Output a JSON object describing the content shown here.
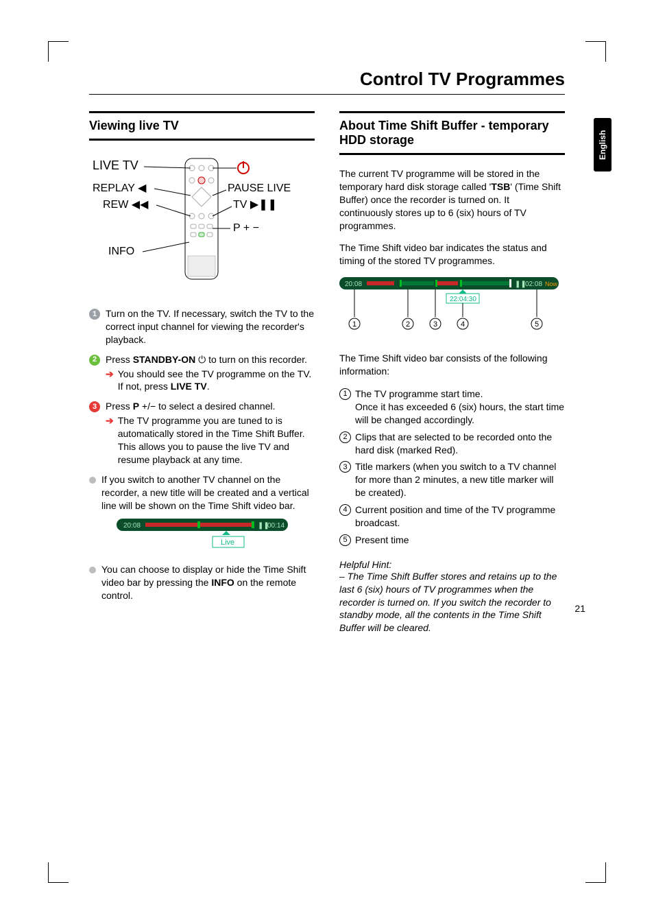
{
  "language_tab": "English",
  "page_title": "Control TV Programmes",
  "page_number": "21",
  "left": {
    "heading": "Viewing live TV",
    "remote": {
      "livetv": "LIVE TV",
      "replay": "REPLAY",
      "rew": "REW",
      "info": "INFO",
      "pauselive": "PAUSE LIVE",
      "tv": "TV",
      "pplusminus": "P"
    },
    "step1": "Turn on the TV.  If necessary, switch the TV to the correct input channel for viewing the recorder's playback.",
    "step2_a": "Press ",
    "step2_b": "STANDBY-ON",
    "step2_c": " to turn on this recorder.",
    "step2_sub_a": "You should see the TV programme on the TV.  If not, press ",
    "step2_sub_b": "LIVE TV",
    "step2_sub_c": ".",
    "step3_a": "Press ",
    "step3_b": "P",
    "step3_c": " +/− to select a desired channel.",
    "step3_sub": "The TV programme you are tuned to is automatically stored in the Time Shift Buffer. This allows you to pause the live TV and resume playback at any time.",
    "bullet1": "If you switch to another TV channel on the recorder, a new title will be created and a vertical line will be shown on the Time Shift video bar.",
    "small_bar_left": "20:08",
    "small_bar_right": "00:14",
    "small_bar_live": "Live",
    "bullet2_a": "You can choose to display or hide the Time Shift video bar by pressing the ",
    "bullet2_b": "INFO",
    "bullet2_c": " on the remote control."
  },
  "right": {
    "heading": "About Time Shift Buffer - temporary HDD storage",
    "p1_a": "The current TV programme will be stored in the temporary hard disk storage called '",
    "p1_b": "TSB",
    "p1_c": "' (Time Shift Buffer) once the recorder is turned on. It continuously stores up to 6 (six) hours of TV programmes.",
    "p2": "The Time Shift video bar indicates the status and timing of the stored TV programmes.",
    "bar_left": "20:08",
    "bar_time": "22:04:30",
    "bar_right": "02:08",
    "bar_now": "Now",
    "c1": "1",
    "c2": "2",
    "c3": "3",
    "c4": "4",
    "c5": "5",
    "p3": "The Time Shift video bar consists of the following information:",
    "i1": "The TV programme start time.\nOnce it has exceeded 6 (six) hours, the start time will be changed accordingly.",
    "i2": "Clips that are selected to be recorded onto the hard disk (marked Red).",
    "i3": "Title markers (when you switch to a TV channel for more than 2 minutes, a new title marker will be created).",
    "i4": "Current position and time of the TV programme broadcast.",
    "i5": "Present time",
    "hint_head": "Helpful Hint:",
    "hint": "–  The Time Shift Buffer stores and retains up to the last 6 (six) hours of TV programmes when the recorder is turned on. If you switch the recorder to standby mode, all the contents in the Time Shift Buffer will be cleared."
  }
}
